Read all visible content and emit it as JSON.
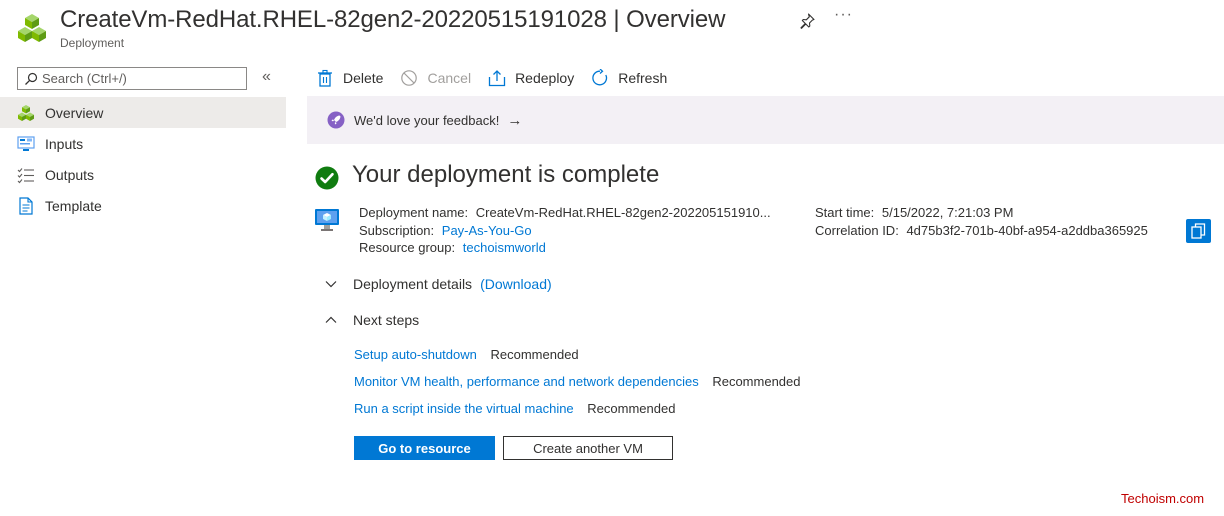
{
  "header": {
    "title": "CreateVm-RedHat.RHEL-82gen2-20220515191028 | Overview",
    "subtitle": "Deployment",
    "more_label": "···"
  },
  "sidebar": {
    "search_placeholder": "Search (Ctrl+/)",
    "collapse_label": "«",
    "items": [
      {
        "label": "Overview",
        "icon": "deployment-cubes-icon",
        "active": true
      },
      {
        "label": "Inputs",
        "icon": "inputs-icon",
        "active": false
      },
      {
        "label": "Outputs",
        "icon": "outputs-list-icon",
        "active": false
      },
      {
        "label": "Template",
        "icon": "template-document-icon",
        "active": false
      }
    ]
  },
  "toolbar": {
    "delete_label": "Delete",
    "cancel_label": "Cancel",
    "redeploy_label": "Redeploy",
    "refresh_label": "Refresh"
  },
  "feedback": {
    "text": "We'd love your feedback!",
    "arrow": "→"
  },
  "deployment": {
    "status_title": "Your deployment is complete",
    "name_label": "Deployment name:",
    "name_value": "CreateVm-RedHat.RHEL-82gen2-202205151910...",
    "subscription_label": "Subscription:",
    "subscription_value": "Pay-As-You-Go",
    "resource_group_label": "Resource group:",
    "resource_group_value": "techoismworld",
    "start_time_label": "Start time:",
    "start_time_value": "5/15/2022, 7:21:03 PM",
    "correlation_label": "Correlation ID:",
    "correlation_value": "4d75b3f2-701b-40bf-a954-a2ddba365925"
  },
  "sections": {
    "details_label": "Deployment details",
    "download_label": "(Download)",
    "next_steps_label": "Next steps"
  },
  "next_steps": [
    {
      "link": "Setup auto-shutdown",
      "tag": "Recommended"
    },
    {
      "link": "Monitor VM health, performance and network dependencies",
      "tag": "Recommended"
    },
    {
      "link": "Run a script inside the virtual machine",
      "tag": "Recommended"
    }
  ],
  "actions": {
    "go_to_resource": "Go to resource",
    "create_another": "Create another VM"
  },
  "watermark": "Techoism.com",
  "colors": {
    "accent": "#0078d4",
    "success": "#107c10",
    "feedback_bg": "#f3f0f5",
    "nav_active_bg": "#edebe9",
    "watermark": "#c00000"
  }
}
